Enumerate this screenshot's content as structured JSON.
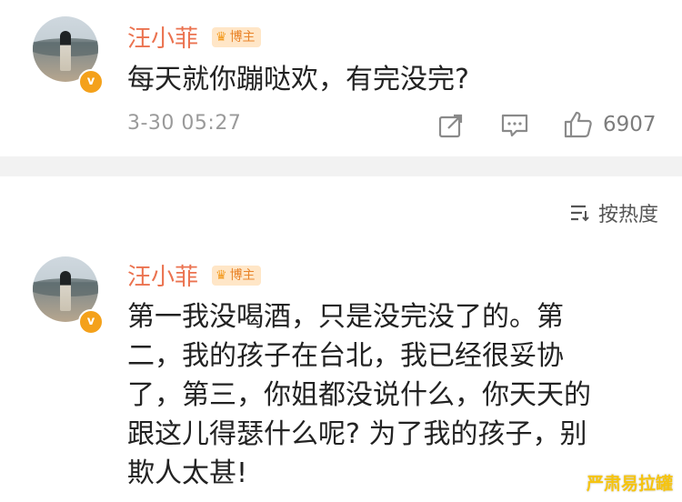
{
  "comments": [
    {
      "username": "汪小菲",
      "badge": "博主",
      "verified_mark": "v",
      "text": "每天就你蹦哒欢，有完没完?",
      "time": "3-30 05:27",
      "likes": "6907"
    },
    {
      "username": "汪小菲",
      "badge": "博主",
      "verified_mark": "v",
      "text_lines": [
        "第一我没喝酒，只是没完没了的。第",
        "二，我的孩子在台北，我已经很妥协",
        "了，第三，你姐都没说什么，你天天的",
        "跟这儿得瑟什么呢? 为了我的孩子，别",
        "欺人太甚!"
      ]
    }
  ],
  "sort": {
    "label": "按热度",
    "icon": "sort-icon"
  },
  "watermark": "严肃易拉罐",
  "icons": {
    "share": "share-icon",
    "comment": "comment-icon",
    "like": "thumbs-up-icon"
  },
  "colors": {
    "username": "#eb7350",
    "badge_bg": "#ffe6c7",
    "verified": "#f4a11b",
    "divider": "#f2f2f2",
    "watermark": "#f6c40e"
  }
}
